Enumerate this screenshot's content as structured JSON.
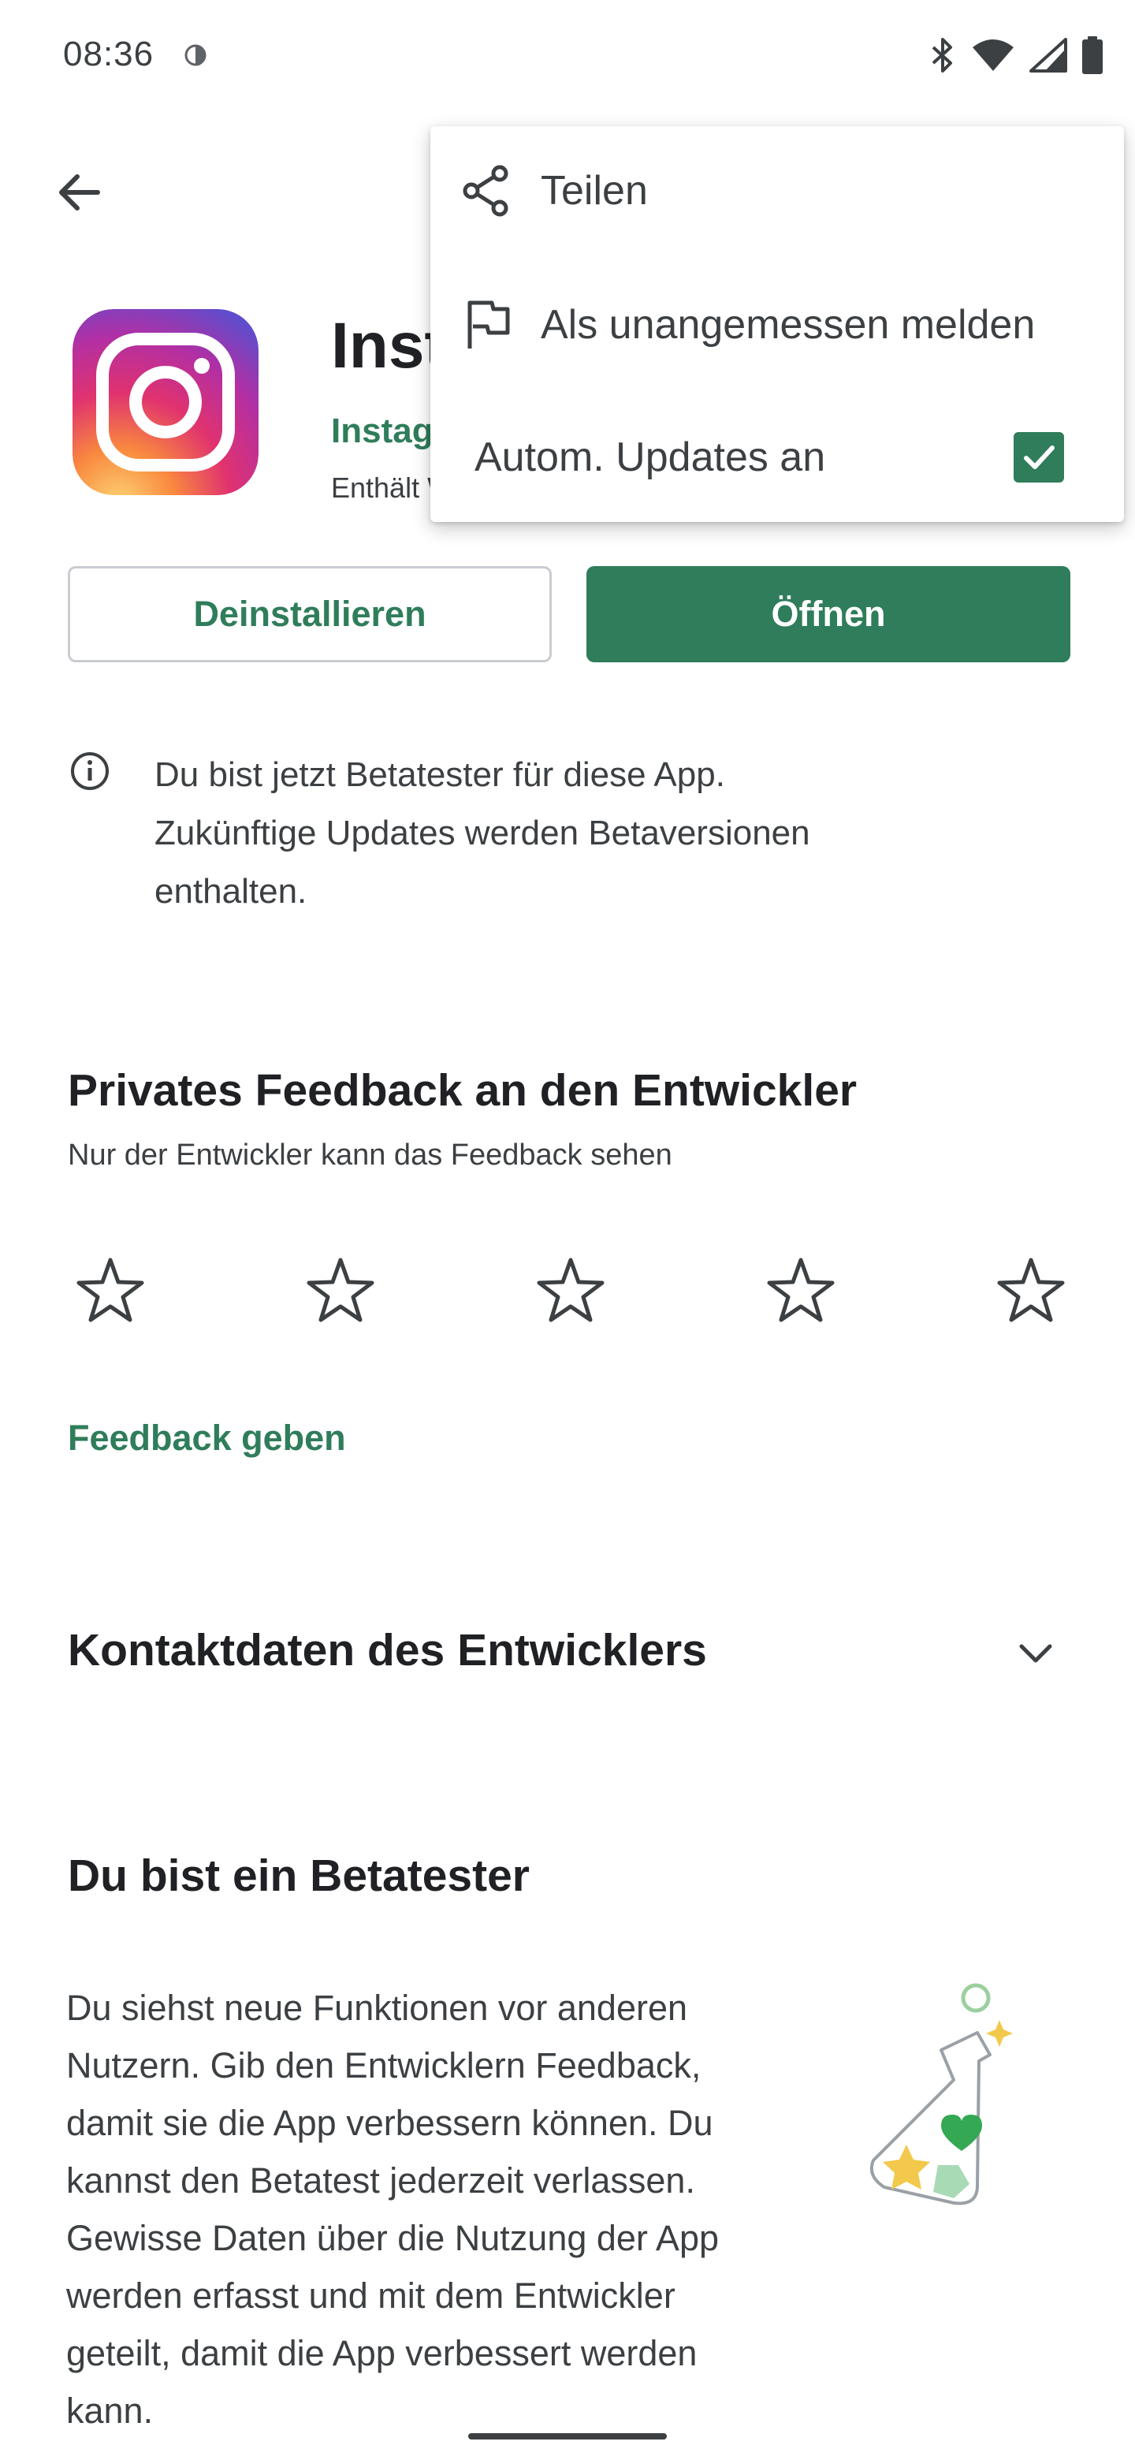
{
  "status_bar": {
    "time": "08:36"
  },
  "app": {
    "title": "Instagram",
    "developer": "Instagram",
    "subtitle": "Enthält Werbung"
  },
  "actions": {
    "uninstall_label": "Deinstallieren",
    "open_label": "Öffnen"
  },
  "beta_notice": {
    "line1": "Du bist jetzt Betatester für diese App.",
    "line2": "Zukünftige Updates werden Betaversionen",
    "line3": "enthalten."
  },
  "feedback": {
    "title": "Privates Feedback an den Entwickler",
    "subtitle": "Nur der Entwickler kann das Feedback sehen",
    "rating_stars": 5,
    "rating_value": 0,
    "link_label": "Feedback geben"
  },
  "contact": {
    "title": "Kontaktdaten des Entwicklers"
  },
  "beta_section": {
    "title": "Du bist ein Betatester",
    "lines": [
      "Du siehst neue Funktionen vor anderen",
      "Nutzern. Gib den Entwicklern Feedback,",
      "damit sie die App verbessern können. Du",
      "kannst den Betatest jederzeit verlassen.",
      "Gewisse Daten über die Nutzung der App",
      "werden erfasst und mit dem Entwickler",
      "geteilt, damit die App verbessert werden",
      "kann."
    ]
  },
  "menu": {
    "items": [
      {
        "label": "Teilen",
        "icon": "share-icon"
      },
      {
        "label": "Als unangemessen melden",
        "icon": "flag-icon"
      },
      {
        "label": "Autom. Updates an",
        "checked": true
      }
    ]
  },
  "colors": {
    "accent": "#2f7d5a",
    "text": "#202124",
    "secondary_text": "#3c4043"
  }
}
